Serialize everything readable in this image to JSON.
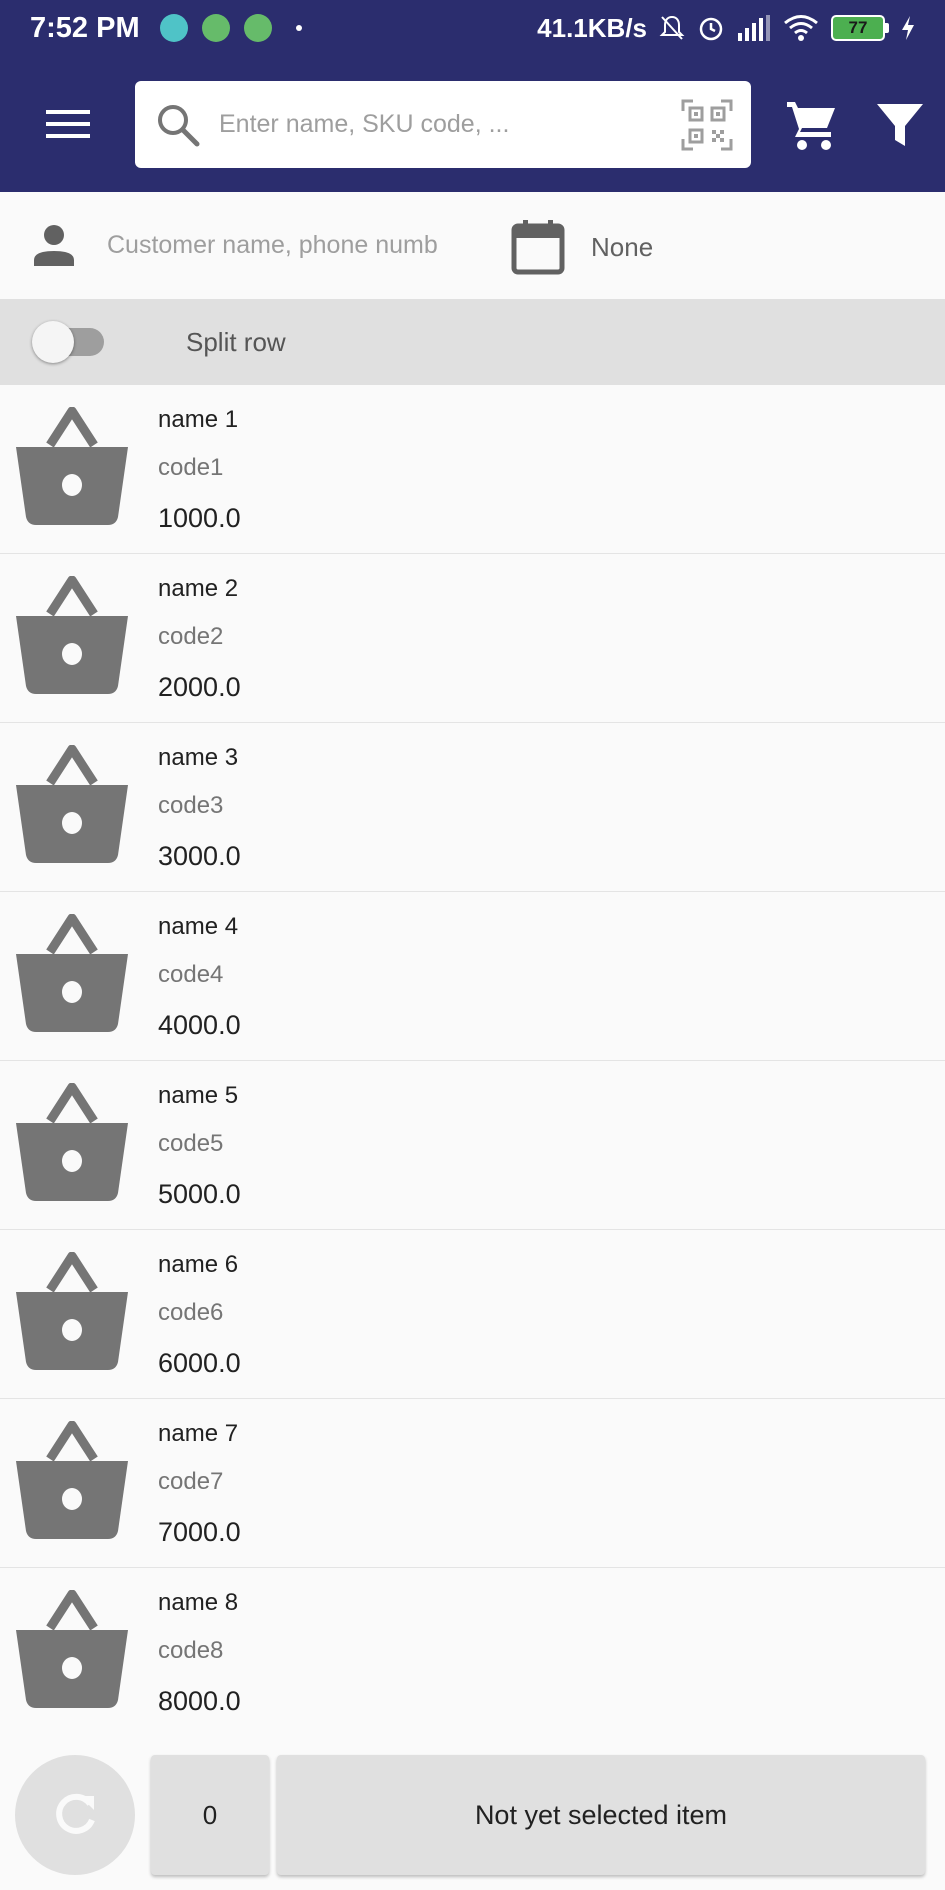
{
  "status_bar": {
    "time": "7:52 PM",
    "speed": "41.1KB/s",
    "battery": "77"
  },
  "app_bar": {
    "search_placeholder": "Enter name, SKU code, ...",
    "icons": [
      "menu-icon",
      "search-icon",
      "qr-code-icon",
      "cart-icon",
      "filter-icon"
    ]
  },
  "customer": {
    "placeholder": "Customer name, phone numb",
    "date_value": "None"
  },
  "split_row": {
    "label": "Split row",
    "enabled": false
  },
  "products": [
    {
      "name": "name 1",
      "code": "code1",
      "price": "1000.0"
    },
    {
      "name": "name 2",
      "code": "code2",
      "price": "2000.0"
    },
    {
      "name": "name 3",
      "code": "code3",
      "price": "3000.0"
    },
    {
      "name": "name 4",
      "code": "code4",
      "price": "4000.0"
    },
    {
      "name": "name 5",
      "code": "code5",
      "price": "5000.0"
    },
    {
      "name": "name 6",
      "code": "code6",
      "price": "6000.0"
    },
    {
      "name": "name 7",
      "code": "code7",
      "price": "7000.0"
    },
    {
      "name": "name 8",
      "code": "code8",
      "price": "8000.0"
    }
  ],
  "bottom_bar": {
    "count": "0",
    "selected_label": "Not yet selected item"
  },
  "colors": {
    "primary": "#2b2d6e",
    "icon_gray": "#757575",
    "surface": "#fafafa",
    "button_gray": "#e0e0e0"
  }
}
